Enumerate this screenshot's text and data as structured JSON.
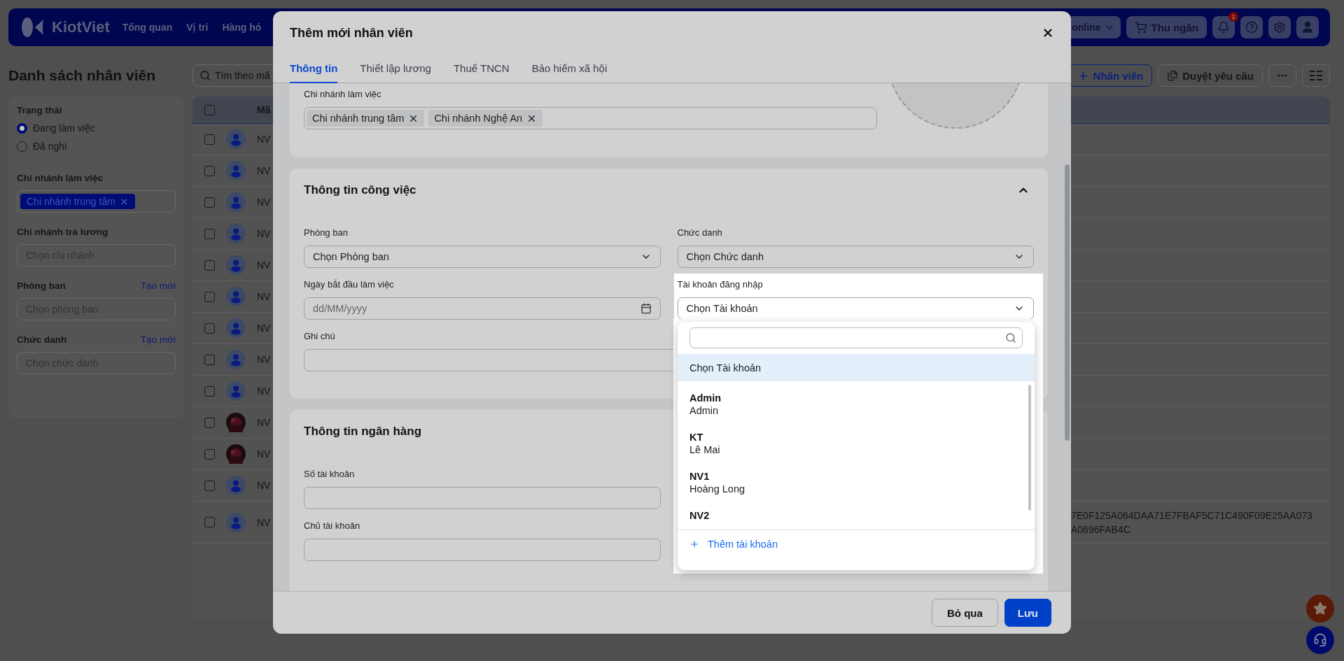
{
  "topbar": {
    "logo": "KiotViet",
    "nav": [
      "Tổng quan",
      "Vị trí",
      "Hàng hó"
    ],
    "branch_button": "online",
    "cashier_button": "Thu ngân",
    "notification_count": "1"
  },
  "page": {
    "title": "Danh sách nhân viên",
    "search_placeholder": "Tìm theo mã",
    "actions": [
      {
        "label": "Nhân viên",
        "kind": "primary"
      },
      {
        "label": "Duyệt yêu cầu",
        "kind": "secondary"
      }
    ]
  },
  "filters": [
    {
      "kind": "radio",
      "title": "Trạng thái",
      "options": [
        {
          "label": "Đang làm việc",
          "selected": true
        },
        {
          "label": "Đã nghỉ",
          "selected": false
        }
      ]
    },
    {
      "kind": "tags",
      "title": "Chi nhánh làm việc",
      "tags": [
        "Chi nhánh trung tâm"
      ]
    },
    {
      "kind": "select",
      "title": "Chi nhánh trả lương",
      "placeholder": "Chọn chi nhánh"
    },
    {
      "kind": "select",
      "title": "Phòng ban",
      "link": "Tạo mới",
      "placeholder": "Chọn phòng ban"
    },
    {
      "kind": "select",
      "title": "Chức danh",
      "link": "Tạo mới",
      "placeholder": "Chọn chức danh"
    }
  ],
  "table": {
    "columns": [
      "Mã"
    ],
    "header_checked": false,
    "rows": [
      {
        "checked": false,
        "kind": "default",
        "code": "NV"
      },
      {
        "checked": false,
        "kind": "default",
        "code": "NV"
      },
      {
        "checked": false,
        "kind": "default",
        "code": "NV"
      },
      {
        "checked": false,
        "kind": "default",
        "code": "NV"
      },
      {
        "checked": false,
        "kind": "default",
        "code": "NV"
      },
      {
        "checked": false,
        "kind": "default",
        "code": "NV"
      },
      {
        "checked": false,
        "kind": "default",
        "code": "NV"
      },
      {
        "checked": false,
        "kind": "default",
        "code": "NV"
      },
      {
        "checked": false,
        "kind": "default",
        "code": "NV"
      },
      {
        "checked": false,
        "code": "NV"
      },
      {
        "checked": false,
        "code": "NV"
      },
      {
        "checked": false,
        "kind": "default",
        "code": "NV"
      },
      {
        "checked": false,
        "kind": "default",
        "code": "NV",
        "note_lines": [
          "7E0F125A064DAA71E7FBAF5C71C490F09E25AA073",
          "A0696FAB4C"
        ]
      }
    ]
  },
  "modal": {
    "title": "Thêm mới nhân viên",
    "tabs": [
      {
        "label": "Thông tin",
        "selected": true
      },
      {
        "label": "Thiết lập lương",
        "selected": false
      },
      {
        "label": "Thuế TNCN",
        "selected": false
      },
      {
        "label": "Bảo hiểm xã hội",
        "selected": false
      }
    ],
    "sections": [
      {
        "fields": [
          {
            "kind": "tags",
            "label": "Chi nhánh làm việc",
            "tags": [
              "Chi nhánh trung tâm",
              "Chi nhánh Nghệ An"
            ]
          }
        ]
      },
      {
        "title": "Thông tin công việc",
        "expanded": true,
        "fields": [
          {
            "kind": "select",
            "label": "Phòng ban",
            "placeholder": "Chọn Phòng ban"
          },
          {
            "kind": "select",
            "label": "Chức danh",
            "placeholder": "Chọn Chức danh"
          },
          {
            "kind": "date",
            "label": "Ngày bắt đầu làm việc",
            "placeholder": "dd/MM/yyyy"
          },
          {
            "kind": "account",
            "label": "Tài khoản đăng nhập",
            "placeholder": "Chọn Tài khoản",
            "open": true
          },
          {
            "kind": "textarea",
            "label": "Ghi chú"
          }
        ]
      },
      {
        "title": "Thông tin ngân hàng",
        "fields": [
          {
            "kind": "text",
            "label": "Số tài khoản"
          },
          {
            "kind": "blank"
          },
          {
            "kind": "text",
            "label": "Chủ tài khoản"
          }
        ]
      }
    ],
    "account_dropdown": {
      "options": [
        {
          "kind": "plain",
          "label": "Chọn Tài khoản",
          "selected": true
        },
        {
          "kind": "account",
          "username": "Admin",
          "name": "Admin",
          "selected": false
        },
        {
          "kind": "account",
          "username": "KT",
          "name": "Lê Mai",
          "selected": false
        },
        {
          "kind": "account",
          "username": "NV1",
          "name": "Hoàng Long",
          "selected": false
        },
        {
          "kind": "account",
          "username": "NV2",
          "selected": false
        }
      ],
      "add_label": "Thêm tài khoản"
    },
    "buttons": [
      {
        "label": "Bỏ qua",
        "kind": "secondary"
      },
      {
        "label": "Lưu",
        "kind": "primary"
      }
    ]
  }
}
